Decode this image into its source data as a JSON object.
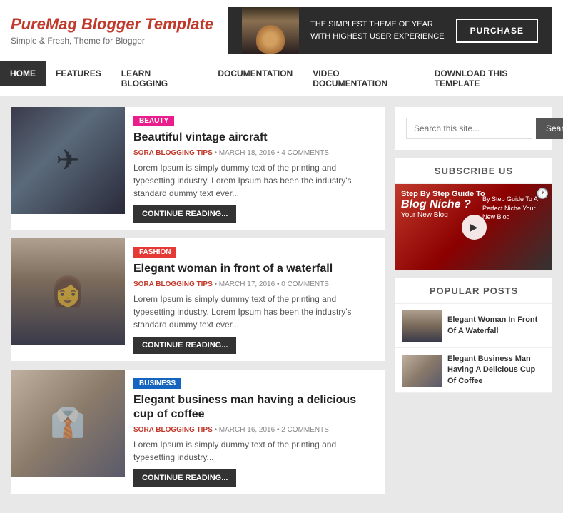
{
  "site": {
    "title": "PureMag Blogger Template",
    "tagline": "Simple & Fresh, Theme for Blogger"
  },
  "banner": {
    "text1": "THE SIMPLEST THEME OF YEAR",
    "text2": "WITH HIGHEST USER EXPERIENCE",
    "button_label": "PURCHASE"
  },
  "nav": {
    "items": [
      {
        "label": "HOME",
        "active": true
      },
      {
        "label": "FEATURES",
        "active": false
      },
      {
        "label": "LEARN BLOGGING",
        "active": false
      },
      {
        "label": "DOCUMENTATION",
        "active": false
      },
      {
        "label": "VIDEO DOCUMENTATION",
        "active": false
      },
      {
        "label": "DOWNLOAD THIS TEMPLATE",
        "active": false
      }
    ]
  },
  "articles": [
    {
      "category": "BEAUTY",
      "category_class": "cat-beauty",
      "title": "Beautiful vintage aircraft",
      "meta_author": "SORA BLOGGING TIPS",
      "meta_date": "MARCH 18, 2016",
      "meta_comments": "4 COMMENTS",
      "excerpt": "Lorem Ipsum is simply dummy text of the printing and typesetting industry. Lorem Ipsum has been the industry's standard dummy text ever...",
      "continue_label": "CONTINUE READING...",
      "thumb_class": "thumb-airplane"
    },
    {
      "category": "FASHION",
      "category_class": "cat-fashion",
      "title": "Elegant woman in front of a waterfall",
      "meta_author": "SORA BLOGGING TIPS",
      "meta_date": "MARCH 17, 2016",
      "meta_comments": "0 COMMENTS",
      "excerpt": "Lorem Ipsum is simply dummy text of the printing and typesetting industry. Lorem Ipsum has been the industry's standard dummy text ever...",
      "continue_label": "CONTINUE READING...",
      "thumb_class": "thumb-woman"
    },
    {
      "category": "BUSINESS",
      "category_class": "cat-business",
      "title": "Elegant business man having a delicious cup of coffee",
      "meta_author": "SORA BLOGGING TIPS",
      "meta_date": "MARCH 16, 2016",
      "meta_comments": "2 COMMENTS",
      "excerpt": "Lorem Ipsum is simply dummy text of the printing and typesetting industry...",
      "continue_label": "CONTINUE READING...",
      "thumb_class": "thumb-business"
    }
  ],
  "sidebar": {
    "search_placeholder": "Search this site...",
    "search_button": "Search",
    "subscribe_title": "SUBSCRIBE US",
    "subscribe_video": {
      "line1": "Step By Step Guide To",
      "line2": "Blog Niche ?",
      "line3": "Your New Blog",
      "desc": "By Step Guide To A Perfect Niche Your New Blog"
    },
    "popular_title": "POPULAR POSTS",
    "popular_posts": [
      {
        "title": "Elegant Woman In Front Of A Waterfall",
        "thumb_class": "pop-thumb1"
      },
      {
        "title": "Elegant Business Man Having A Delicious Cup Of Coffee",
        "thumb_class": "pop-thumb2"
      }
    ]
  }
}
